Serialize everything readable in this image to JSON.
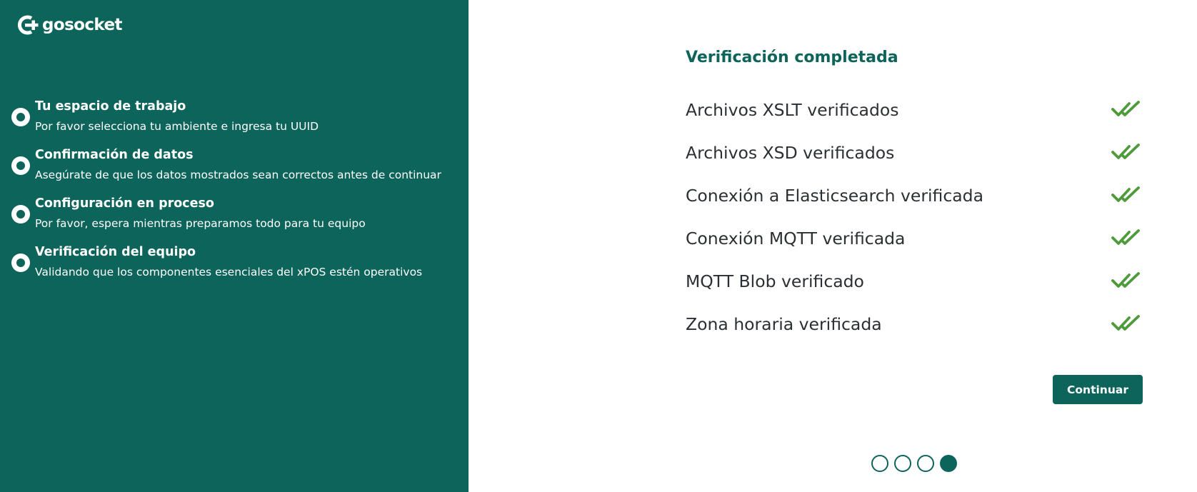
{
  "brand": {
    "name": "gosocket",
    "color": "#0d645a"
  },
  "steps": [
    {
      "title": "Tu espacio de trabajo",
      "description": "Por favor selecciona tu ambiente e ingresa tu UUID"
    },
    {
      "title": "Confirmación de datos",
      "description": "Asegúrate de que los datos mostrados sean correctos antes de continuar"
    },
    {
      "title": "Configuración en proceso",
      "description": "Por favor, espera mientras preparamos todo para tu equipo"
    },
    {
      "title": "Verificación del equipo",
      "description": "Validando que los componentes esenciales del xPOS estén operativos"
    }
  ],
  "main": {
    "heading": "Verificación completada",
    "checks": [
      {
        "label": "Archivos XSLT verificados",
        "icon": "double-check-icon",
        "status": "verified"
      },
      {
        "label": "Archivos XSD verificados",
        "icon": "double-check-icon",
        "status": "verified"
      },
      {
        "label": "Conexión a Elasticsearch verificada",
        "icon": "double-check-icon",
        "status": "verified"
      },
      {
        "label": "Conexión MQTT verificada",
        "icon": "double-check-icon",
        "status": "verified"
      },
      {
        "label": "MQTT Blob verificado",
        "icon": "double-check-icon",
        "status": "verified"
      },
      {
        "label": "Zona horaria verificada",
        "icon": "double-check-icon",
        "status": "verified"
      }
    ],
    "continue_label": "Continuar",
    "check_color": "#4f9a3c"
  },
  "pagination": {
    "total": 4,
    "current": 4
  }
}
